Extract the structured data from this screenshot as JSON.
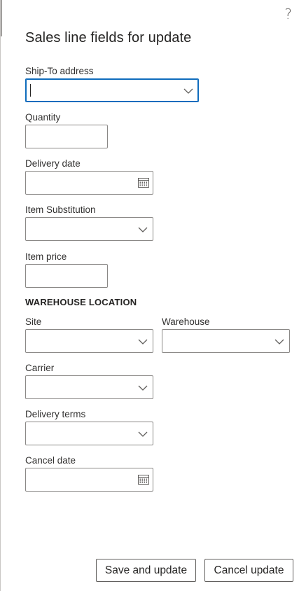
{
  "dialog": {
    "help_glyph": "?",
    "title": "Sales line fields for update"
  },
  "fields": {
    "ship_to_address": {
      "label": "Ship-To address",
      "value": ""
    },
    "quantity": {
      "label": "Quantity",
      "value": ""
    },
    "delivery_date": {
      "label": "Delivery date",
      "value": ""
    },
    "item_substitution": {
      "label": "Item Substitution",
      "value": ""
    },
    "item_price": {
      "label": "Item price",
      "value": ""
    },
    "warehouse_location": {
      "heading": "WAREHOUSE LOCATION",
      "site": {
        "label": "Site",
        "value": ""
      },
      "warehouse": {
        "label": "Warehouse",
        "value": ""
      }
    },
    "carrier": {
      "label": "Carrier",
      "value": ""
    },
    "delivery_terms": {
      "label": "Delivery terms",
      "value": ""
    },
    "cancel_date": {
      "label": "Cancel date",
      "value": ""
    }
  },
  "buttons": {
    "save": "Save and update",
    "cancel": "Cancel update"
  },
  "icons": {
    "dropdown": "chevron-down-icon",
    "date_picker": "calendar-icon",
    "help": "help-icon"
  },
  "colors": {
    "focus_border": "#0f6cbd",
    "field_border": "#8a8886",
    "text": "#323130"
  }
}
